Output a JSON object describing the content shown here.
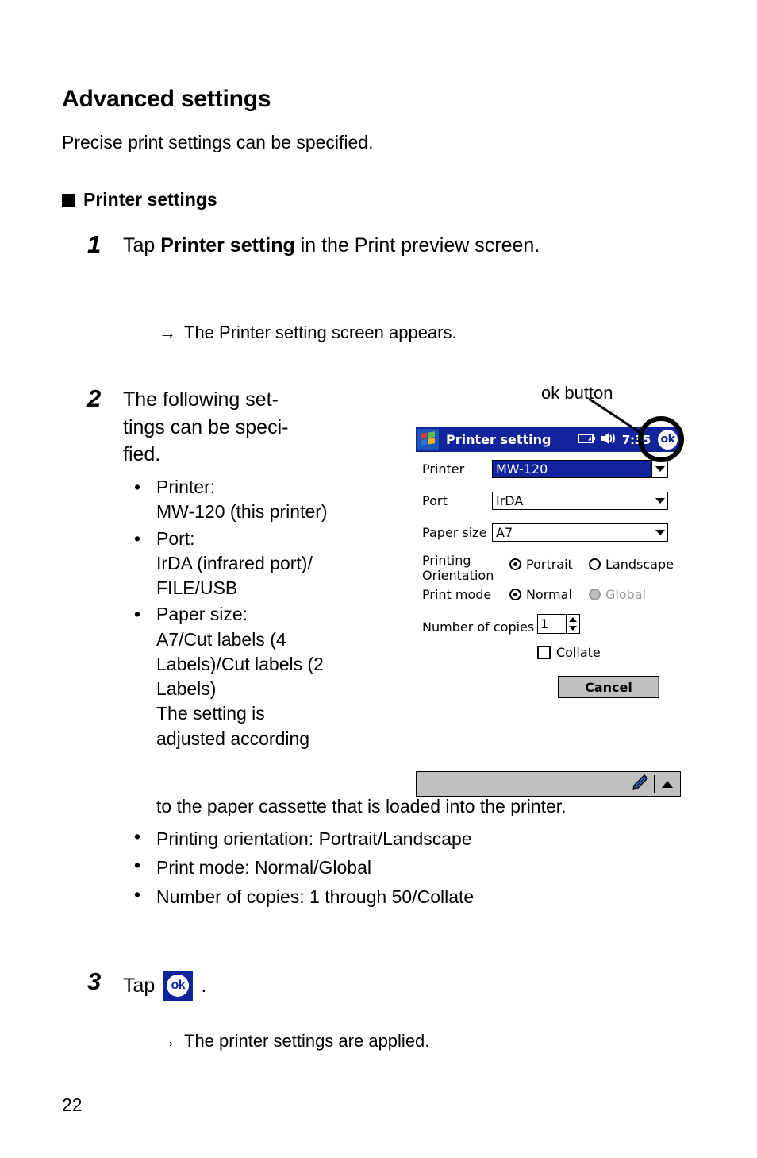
{
  "page": {
    "heading": "Advanced settings",
    "intro": "Precise print settings can be specified.",
    "section_heading": "Printer settings",
    "page_number": "22"
  },
  "steps": [
    {
      "number": "1",
      "text_before_bold": "Tap ",
      "bold": "Printer setting",
      "text_after_bold": " in the Print preview screen.",
      "note": "The Printer setting screen appears."
    },
    {
      "number": "2",
      "text": "The following set-\ntings can be speci-\nfied.",
      "bullets": [
        {
          "label": "Printer:",
          "detail": "MW-120 (this printer)"
        },
        {
          "label": "Port:",
          "detail": "IrDA (infrared port)/\nFILE/USB"
        },
        {
          "label": "Paper size:",
          "detail": "A7/Cut labels (4\nLabels)/Cut labels (2\nLabels)\nThe setting is\nadjusted according"
        }
      ],
      "bullets_continuation": "to the paper cassette that is loaded into the printer.",
      "bullets_wide": [
        "Printing orientation: Portrait/Landscape",
        "Print mode: Normal/Global",
        "Number of copies: 1 through 50/Collate"
      ]
    },
    {
      "number": "3",
      "text": "Tap",
      "trailing": ".",
      "note": "The printer settings are applied."
    }
  ],
  "annotation": {
    "ok_button_label": "ok button"
  },
  "screenshot": {
    "titlebar": {
      "title": "Printer setting",
      "time": "7:35",
      "ok_label": "ok",
      "start_icon": "windows-flag-icon",
      "battery_icon": "battery-icon",
      "speaker_icon": "speaker-icon"
    },
    "fields": {
      "printer_label": "Printer",
      "printer_value": "MW-120",
      "port_label": "Port",
      "port_value": "IrDA",
      "paper_size_label": "Paper size",
      "paper_size_value": "A7",
      "printing_orientation_label_1": "Printing",
      "printing_orientation_label_2": "Orientation",
      "orientation_portrait": "Portrait",
      "orientation_landscape": "Landscape",
      "print_mode_label": "Print mode",
      "print_mode_normal": "Normal",
      "print_mode_global": "Global",
      "copies_label": "Number of copies",
      "copies_value": "1",
      "collate_label": "Collate",
      "cancel_label": "Cancel"
    },
    "taskbar": {
      "input_icon": "stylus-pencil-icon",
      "expand_icon": "chevron-up-icon"
    },
    "colors": {
      "titlebar_blue": "#11249b",
      "selection_blue": "#11249b",
      "button_gray": "#c0c0c0",
      "disabled_gray": "#9a9a9a"
    }
  },
  "ok_inline_icon": "ok-button-icon"
}
